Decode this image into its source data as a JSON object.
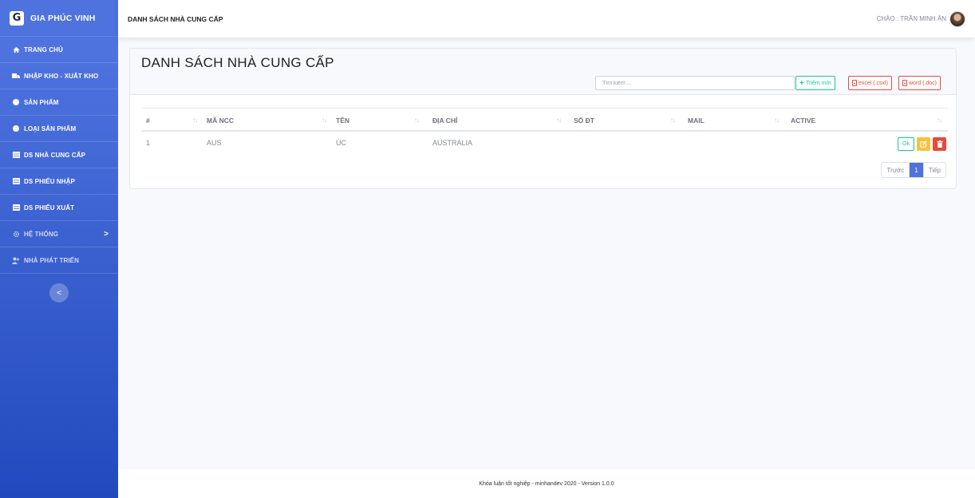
{
  "brand": {
    "logo_letter": "G",
    "name": "GIA PHÚC VINH"
  },
  "sidebar": {
    "items": [
      {
        "label": "TRANG CHỦ",
        "icon": "home-icon"
      },
      {
        "label": "NHẬP KHO - XUẤT KHO",
        "icon": "truck-icon"
      },
      {
        "label": "SẢN PHẨM",
        "icon": "circle-icon"
      },
      {
        "label": "LOẠI SẢN PHẨM",
        "icon": "circle-icon"
      },
      {
        "label": "DS NHÀ CUNG CẤP",
        "icon": "table-icon"
      },
      {
        "label": "DS PHIẾU NHẬP",
        "icon": "table-icon"
      },
      {
        "label": "DS PHIẾU XUẤT",
        "icon": "table-icon"
      },
      {
        "label": "HỆ THỐNG",
        "icon": "gear-icon",
        "caret": ">"
      },
      {
        "label": "NHÀ PHÁT TRIỂN",
        "icon": "users-icon"
      }
    ],
    "toggle": "<"
  },
  "topbar": {
    "title": "DANH SÁCH NHÀ CUNG CẤP",
    "greeting": "CHÀO : TRẦN MINH ÂN"
  },
  "card": {
    "title": "DANH SÁCH NHÀ CUNG CẤP",
    "search_placeholder": "Tìm kiếm ...",
    "add_label": "Thêm mới",
    "excel_label": "excel (.csxl)",
    "word_label": "word (.doc)"
  },
  "table": {
    "columns": [
      "#",
      "MÃ NCC",
      "TÊN",
      "ĐỊA CHỈ",
      "SỐ ĐT",
      "MAIL",
      "ACTIVE"
    ],
    "sort_icon": "↑↓",
    "rows": [
      {
        "index": "1",
        "code": "AUS",
        "name": "ÚC",
        "address": "AUSTRALIA",
        "phone": "",
        "mail": "",
        "active": ""
      }
    ],
    "row_action_ok": "Ok"
  },
  "pagination": {
    "prev": "Trước",
    "current": "1",
    "next": "Tiếp"
  },
  "footer": {
    "text": "Khóa luận tốt nghiệp - minhandev 2020 - Version 1.0.0"
  },
  "colors": {
    "primary": "#4e73df",
    "success": "#1cc88a",
    "danger": "#e74a3b",
    "warning": "#f6c23e"
  }
}
